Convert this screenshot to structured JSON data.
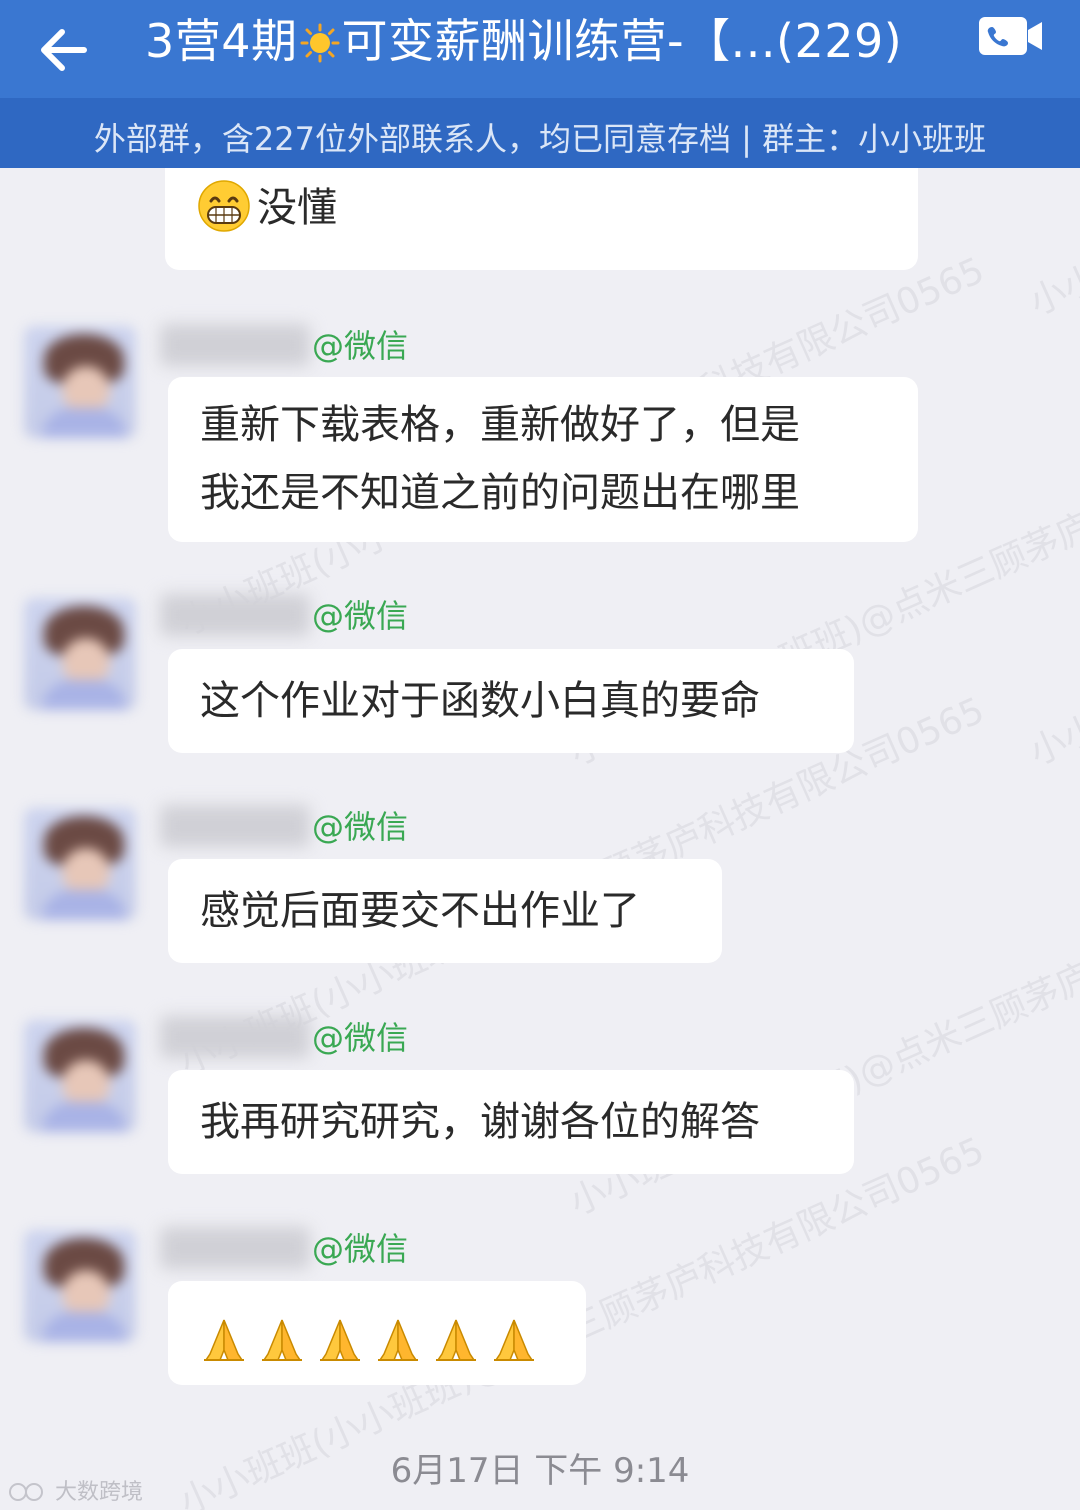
{
  "header": {
    "title_prefix": "3营4期",
    "title_suffix": "可变薪酬训练营-【...(229)",
    "subtitle": "外部群，含227位外部联系人，均已同意存档 | 群主：小小班班"
  },
  "messages": [
    {
      "text": "没懂",
      "emoji": "grinning-face"
    },
    {
      "sender_suffix": "@微信",
      "text_lines": [
        "重新下载表格，重新做好了，但是",
        "我还是不知道之前的问题出在哪里"
      ]
    },
    {
      "sender_suffix": "@微信",
      "text": "这个作业对于函数小白真的要命"
    },
    {
      "sender_suffix": "@微信",
      "text": "感觉后面要交不出作业了"
    },
    {
      "sender_suffix": "@微信",
      "text": "我再研究研究，谢谢各位的解答"
    },
    {
      "sender_suffix": "@微信",
      "emoji": "folded-hands",
      "emoji_count": 6
    }
  ],
  "timestamp": "6月17日   下午 9:14",
  "watermark_texts": [
    "小小班班(小小班班)@点米三顾茅庐科技有限公司0565"
  ],
  "brand_watermark": "大数跨境",
  "colors": {
    "header": "#3a77d1",
    "subheader": "#2f68c2",
    "wechat_green": "#3aa853",
    "background": "#efeff4"
  }
}
